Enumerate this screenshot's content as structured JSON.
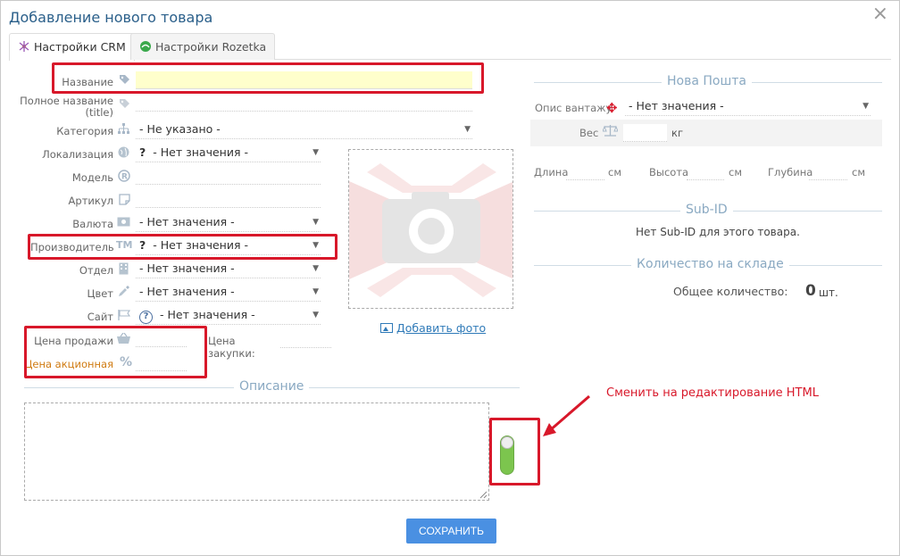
{
  "window": {
    "title": "Добавление нового товара",
    "close": "×"
  },
  "tabs": [
    {
      "label": "Настройки CRM",
      "active": true
    },
    {
      "label": "Настройки Rozetka",
      "active": false
    }
  ],
  "form": {
    "name_label": "Название",
    "fullname_label": "Полное название",
    "fullname_sub": "(title)",
    "category_label": "Категория",
    "category_value": "- Не указано -",
    "localization_label": "Локализация",
    "localization_value": "- Нет значения -",
    "model_label": "Модель",
    "article_label": "Артикул",
    "currency_label": "Валюта",
    "currency_value": "- Нет значения -",
    "manufacturer_label": "Производитель",
    "manufacturer_value": "- Нет значения -",
    "department_label": "Отдел",
    "department_value": "- Нет значения -",
    "color_label": "Цвет",
    "color_value": "- Нет значения -",
    "site_label": "Сайт",
    "site_value": "- Нет значения -",
    "sale_price_label": "Цена продажи",
    "promo_price_label": "Цена акционная",
    "purchase_price_label": "Цена закупки:"
  },
  "photo": {
    "add_label": "Добавить фото"
  },
  "description": {
    "title": "Описание"
  },
  "annotation": {
    "text": "Сменить на редактирование HTML"
  },
  "nova_poshta": {
    "title": "Нова Пошта",
    "cargo_label": "Опис вантажу",
    "cargo_value": "- Нет значения -",
    "weight_label": "Вес",
    "weight_unit": "кг",
    "length_label": "Длина",
    "height_label": "Высота",
    "depth_label": "Глубина",
    "cm": "см"
  },
  "subid": {
    "title": "Sub-ID",
    "empty": "Нет Sub-ID для этого товара."
  },
  "stock": {
    "title": "Количество на складе",
    "total_label": "Общее количество:",
    "total_value": "0",
    "unit": "шт."
  },
  "save_button": "СОХРАНИТЬ",
  "colors": {
    "accent": "#4a90e2",
    "annotation": "#d8182a",
    "toggle": "#7cc54e",
    "title": "#2a5f8a"
  }
}
